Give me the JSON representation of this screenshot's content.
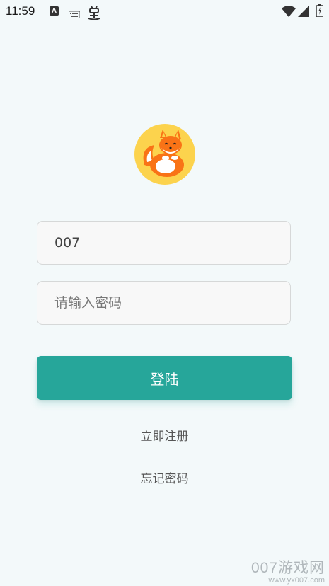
{
  "status_bar": {
    "time": "11:59",
    "icons": [
      "a-notification-icon",
      "keyboard-icon",
      "bug-icon",
      "wifi-icon",
      "signal-icon",
      "battery-icon"
    ],
    "a_glyph": "A"
  },
  "app": {
    "logo": "fox-mascot-logo"
  },
  "login_form": {
    "username_value": "007",
    "password_placeholder": "请输入密码",
    "login_label": "登陆",
    "register_label": "立即注册",
    "forgot_label": "忘记密码"
  },
  "watermark": {
    "brand": "007游戏网",
    "url": "www.yx007.com"
  },
  "colors": {
    "background": "#f3f9fa",
    "primary": "#26a69a",
    "avatar_bg": "#fcd34d",
    "fox_orange": "#f97316"
  }
}
